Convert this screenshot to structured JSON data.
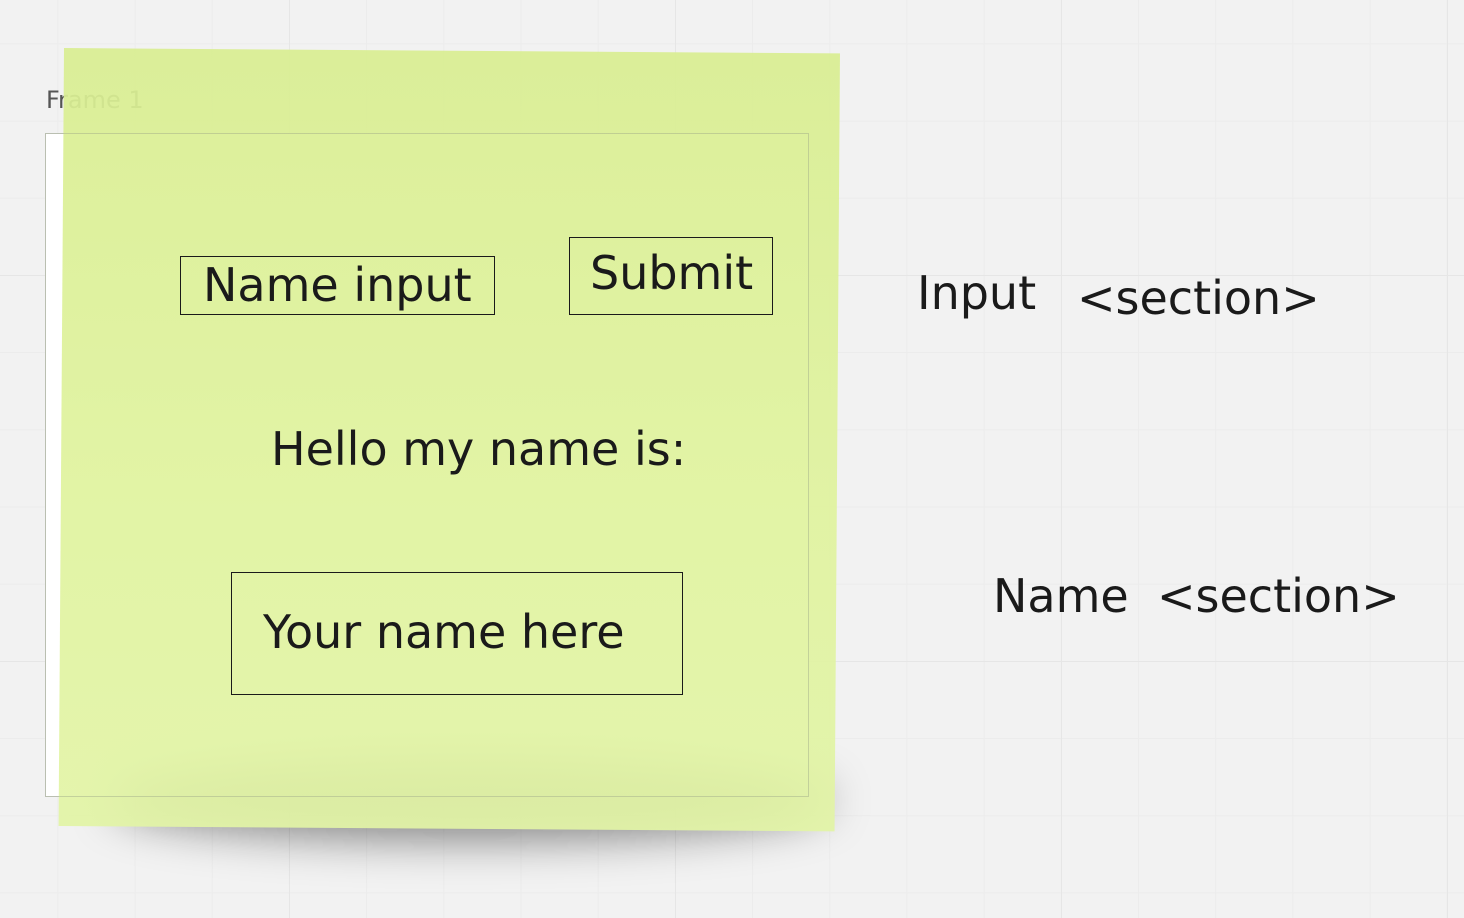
{
  "frame": {
    "label": "Frame 1"
  },
  "sticky_note": {
    "color": "#dff29c",
    "name_input_label": "Name input",
    "submit_label": "Submit",
    "greeting_text": "Hello my name is:",
    "name_output_label": "Your name here"
  },
  "annotations": {
    "input_label": "Input",
    "input_tag": "<section>",
    "name_label": "Name",
    "name_tag": "<section>"
  }
}
